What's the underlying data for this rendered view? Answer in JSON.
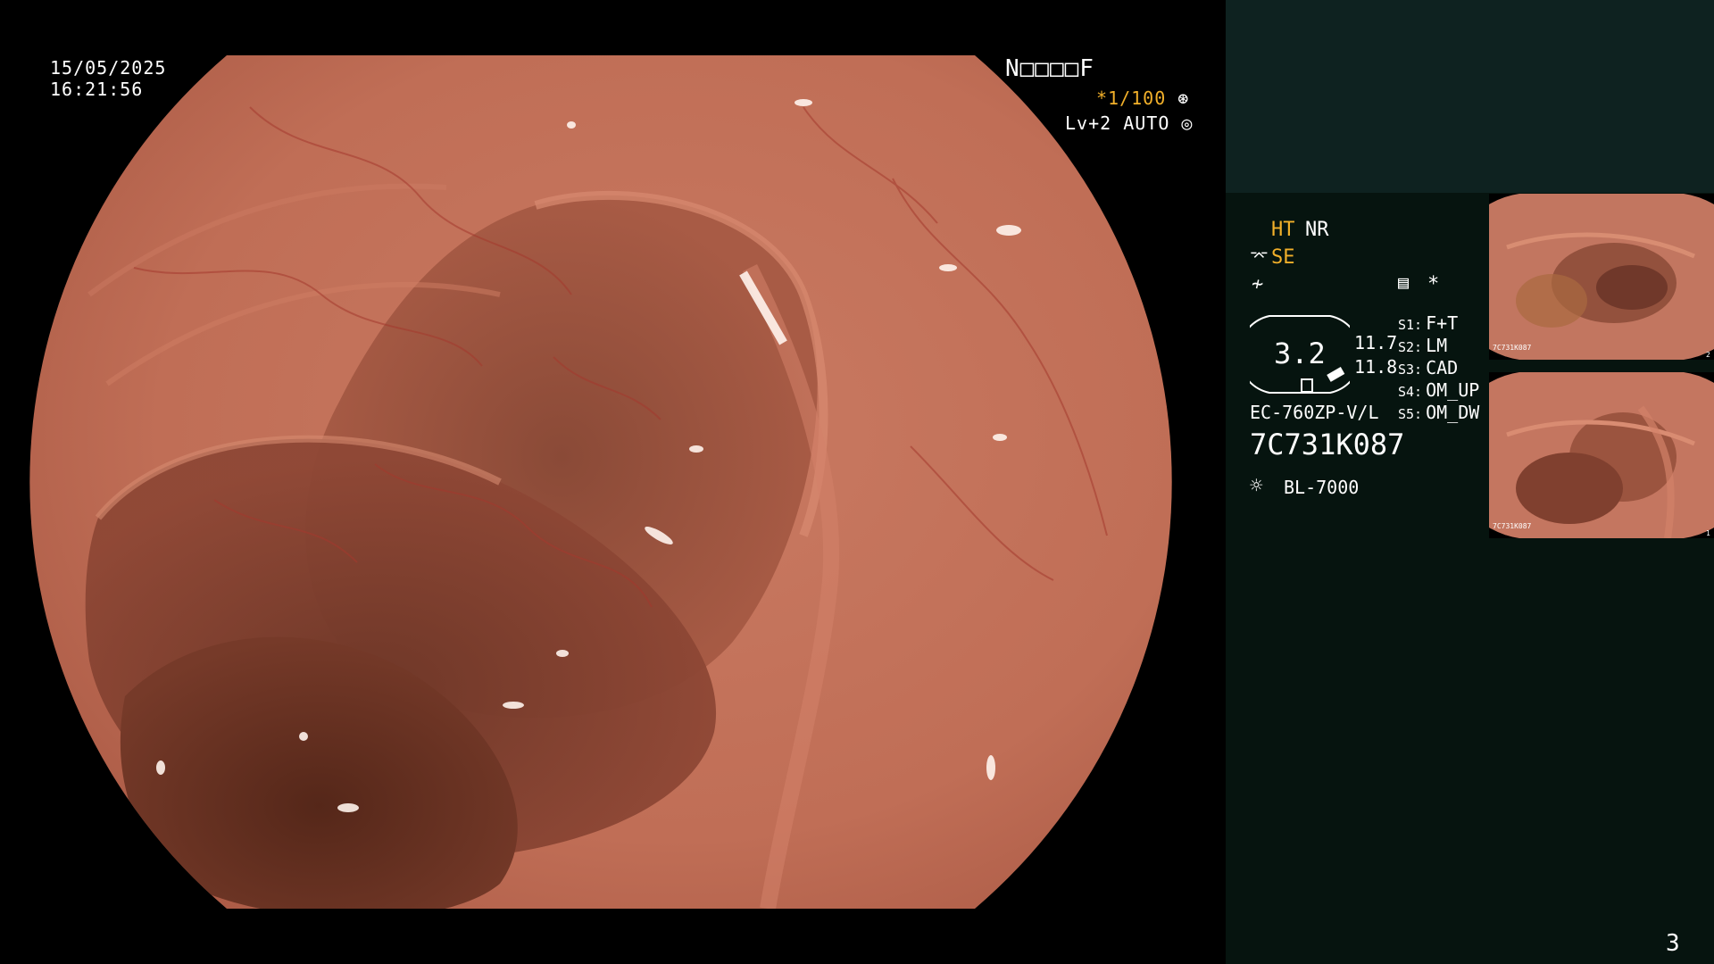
{
  "overlay": {
    "date": "15/05/2025",
    "time": "16:21:56",
    "mode_code": "N□□□□F",
    "shutter": "*1/100",
    "shutter_icon": "aperture-icon",
    "level": "Lv+2 AUTO",
    "level_icon": "iris-icon"
  },
  "panel": {
    "ht_label": "HT",
    "nr_label": "NR",
    "se_label": "SE",
    "se_icon": "scope-tip-icon",
    "freeze_icon": "freeze-slash-icon",
    "memo_icon": "memo-icon",
    "asterisk": "*",
    "gauge_value": "3.2",
    "gauge_v1": "11.7",
    "gauge_v2": "11.8",
    "scope_model": "EC-760ZP-V/L",
    "serial": "7C731K087",
    "light_source": "BL-7000",
    "light_icon": "lamp-icon",
    "settings": [
      {
        "key": "S1:",
        "value": "F+T"
      },
      {
        "key": "S2:",
        "value": "LM"
      },
      {
        "key": "S3:",
        "value": "CAD"
      },
      {
        "key": "S4:",
        "value": "OM_UP"
      },
      {
        "key": "S5:",
        "value": "OM_DW"
      }
    ],
    "thumbnails": [
      {
        "name": "thumbnail-1",
        "serial": "7C731K087",
        "index": "2"
      },
      {
        "name": "thumbnail-2",
        "serial": "7C731K087",
        "index": "1"
      }
    ]
  },
  "page_number": "3",
  "colors": {
    "panel_bg": "#06140f",
    "panel_top": "#0e2220",
    "accent_amber": "#f2b02a",
    "mucosa": "#c0705a"
  }
}
